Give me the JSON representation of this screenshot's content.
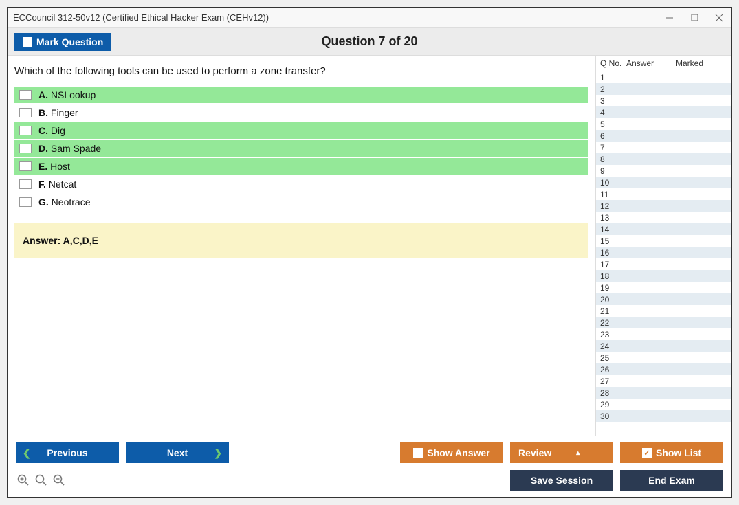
{
  "window": {
    "title": "ECCouncil 312-50v12 (Certified Ethical Hacker Exam (CEHv12))"
  },
  "header": {
    "mark_label": "Mark Question",
    "question_counter": "Question 7 of 20"
  },
  "question": {
    "text": "Which of the following tools can be used to perform a zone transfer?",
    "options": [
      {
        "letter": "A.",
        "text": "NSLookup",
        "correct": true
      },
      {
        "letter": "B.",
        "text": "Finger",
        "correct": false
      },
      {
        "letter": "C.",
        "text": "Dig",
        "correct": true
      },
      {
        "letter": "D.",
        "text": "Sam Spade",
        "correct": true
      },
      {
        "letter": "E.",
        "text": "Host",
        "correct": true
      },
      {
        "letter": "F.",
        "text": "Netcat",
        "correct": false
      },
      {
        "letter": "G.",
        "text": "Neotrace",
        "correct": false
      }
    ],
    "answer_label": "Answer: A,C,D,E"
  },
  "sidebar": {
    "col_qno": "Q No.",
    "col_answer": "Answer",
    "col_marked": "Marked",
    "rows": [
      1,
      2,
      3,
      4,
      5,
      6,
      7,
      8,
      9,
      10,
      11,
      12,
      13,
      14,
      15,
      16,
      17,
      18,
      19,
      20,
      21,
      22,
      23,
      24,
      25,
      26,
      27,
      28,
      29,
      30
    ]
  },
  "footer": {
    "previous": "Previous",
    "next": "Next",
    "show_answer": "Show Answer",
    "review": "Review",
    "show_list": "Show List",
    "save_session": "Save Session",
    "end_exam": "End Exam"
  }
}
